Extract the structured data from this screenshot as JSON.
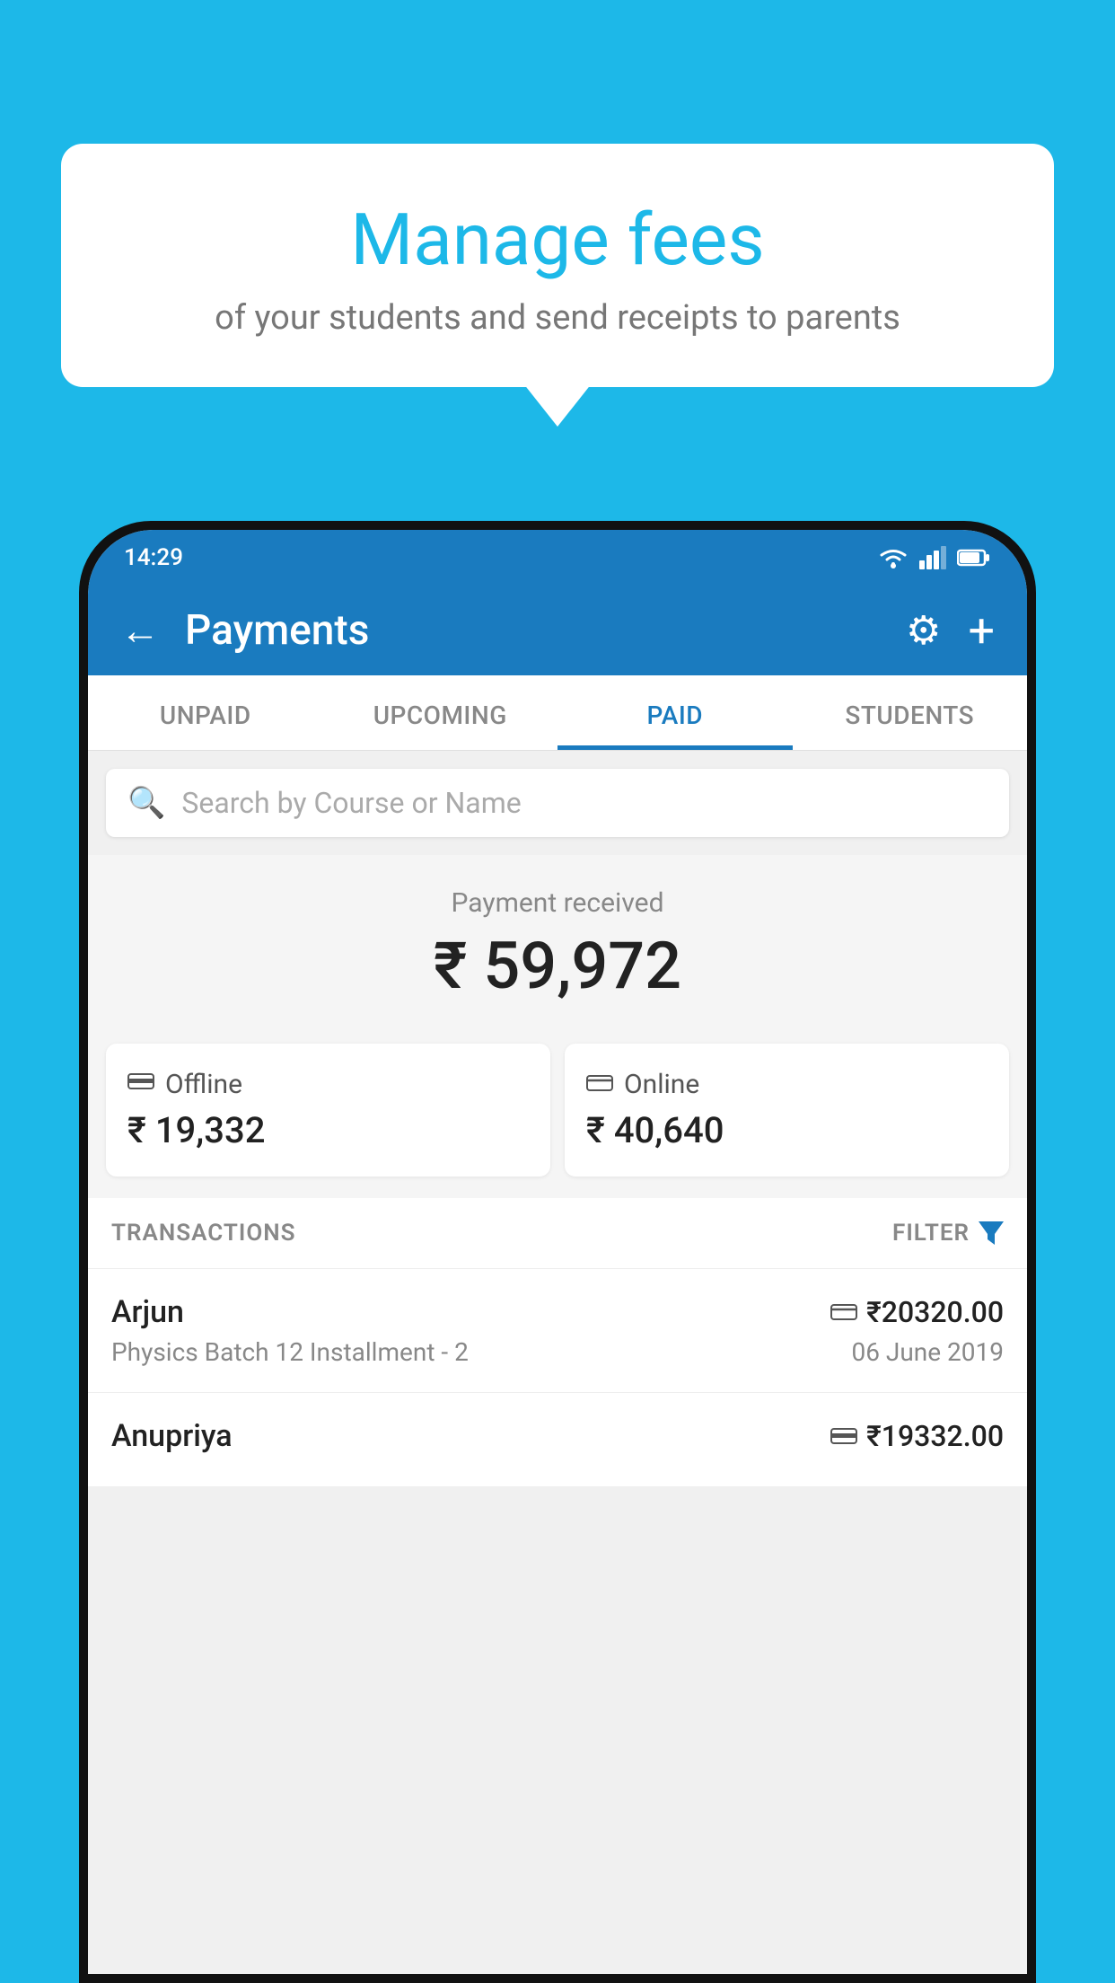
{
  "bubble": {
    "title": "Manage fees",
    "subtitle": "of your students and send receipts to parents"
  },
  "status_bar": {
    "time": "14:29"
  },
  "app_bar": {
    "title": "Payments",
    "back_label": "←",
    "gear_label": "⚙",
    "plus_label": "+"
  },
  "tabs": [
    {
      "id": "unpaid",
      "label": "UNPAID",
      "active": false
    },
    {
      "id": "upcoming",
      "label": "UPCOMING",
      "active": false
    },
    {
      "id": "paid",
      "label": "PAID",
      "active": true
    },
    {
      "id": "students",
      "label": "STUDENTS",
      "active": false
    }
  ],
  "search": {
    "placeholder": "Search by Course or Name"
  },
  "payment_summary": {
    "label": "Payment received",
    "amount": "₹ 59,972"
  },
  "payment_cards": [
    {
      "id": "offline",
      "label": "Offline",
      "amount": "₹ 19,332",
      "icon": "💳"
    },
    {
      "id": "online",
      "label": "Online",
      "amount": "₹ 40,640",
      "icon": "💳"
    }
  ],
  "transactions_header": {
    "label": "TRANSACTIONS",
    "filter_label": "FILTER"
  },
  "transactions": [
    {
      "name": "Arjun",
      "course": "Physics Batch 12 Installment - 2",
      "amount": "₹20320.00",
      "date": "06 June 2019",
      "payment_type": "online"
    },
    {
      "name": "Anupriya",
      "course": "",
      "amount": "₹19332.00",
      "date": "",
      "payment_type": "offline"
    }
  ],
  "colors": {
    "brand_blue": "#1a7bbf",
    "background_blue": "#1db8e8",
    "white": "#ffffff",
    "light_gray": "#f5f5f5",
    "text_dark": "#222222",
    "text_gray": "#888888"
  }
}
